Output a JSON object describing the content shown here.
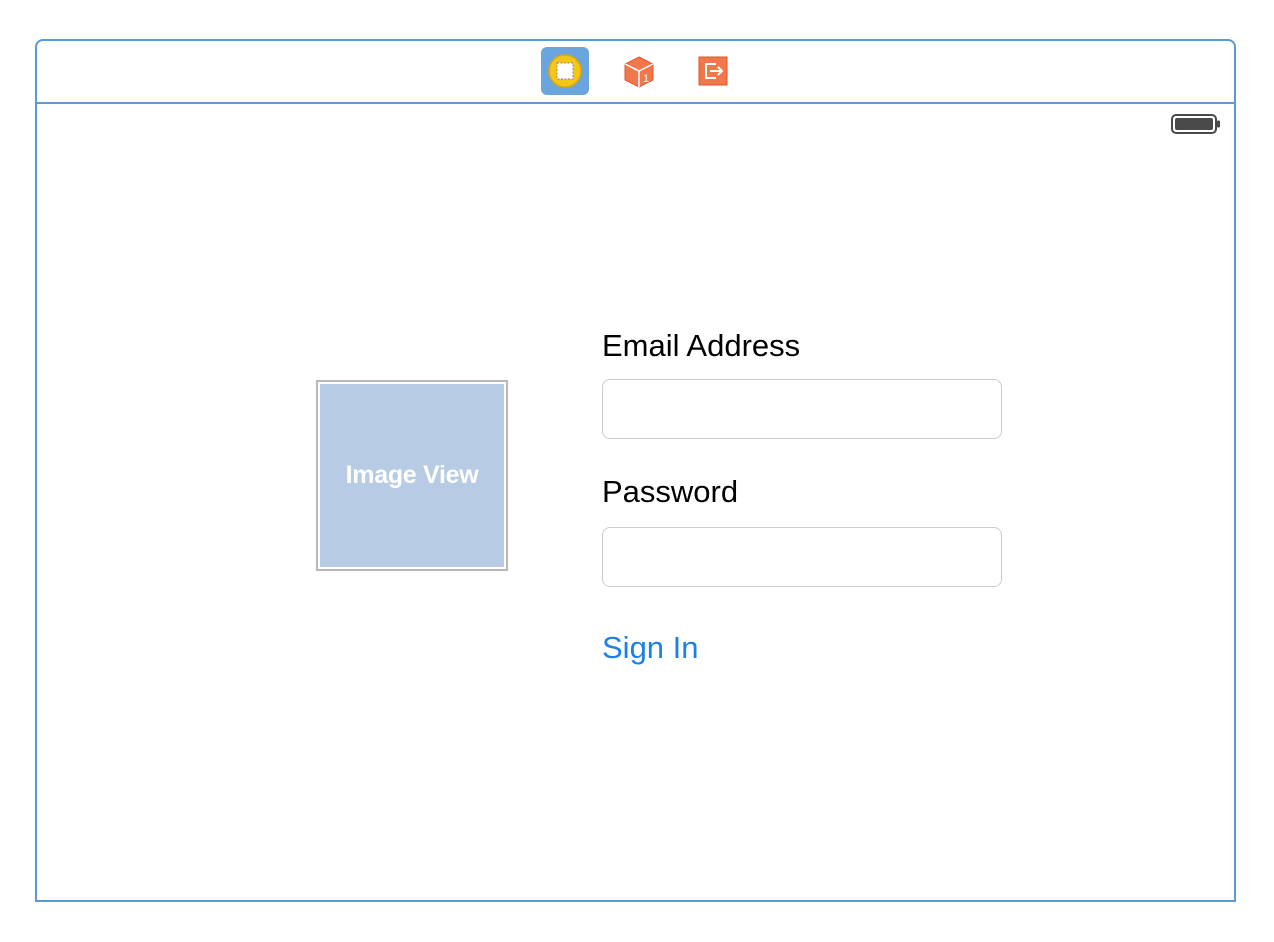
{
  "dock": {
    "icons": [
      {
        "name": "view-controller-icon",
        "selected": true
      },
      {
        "name": "first-responder-icon",
        "selected": false
      },
      {
        "name": "exit-icon",
        "selected": false
      }
    ]
  },
  "status_bar": {
    "battery": "battery-icon"
  },
  "image_view": {
    "label": "Image View"
  },
  "form": {
    "email_label": "Email Address",
    "email_value": "",
    "password_label": "Password",
    "password_value": "",
    "sign_in_label": "Sign In"
  },
  "colors": {
    "scene_border": "#5b9bd5",
    "selected_dock": "#6aa5dd",
    "image_view_fill": "#b7cce4",
    "tint": "#1a82e6",
    "orange_icon": "#f2784b"
  }
}
